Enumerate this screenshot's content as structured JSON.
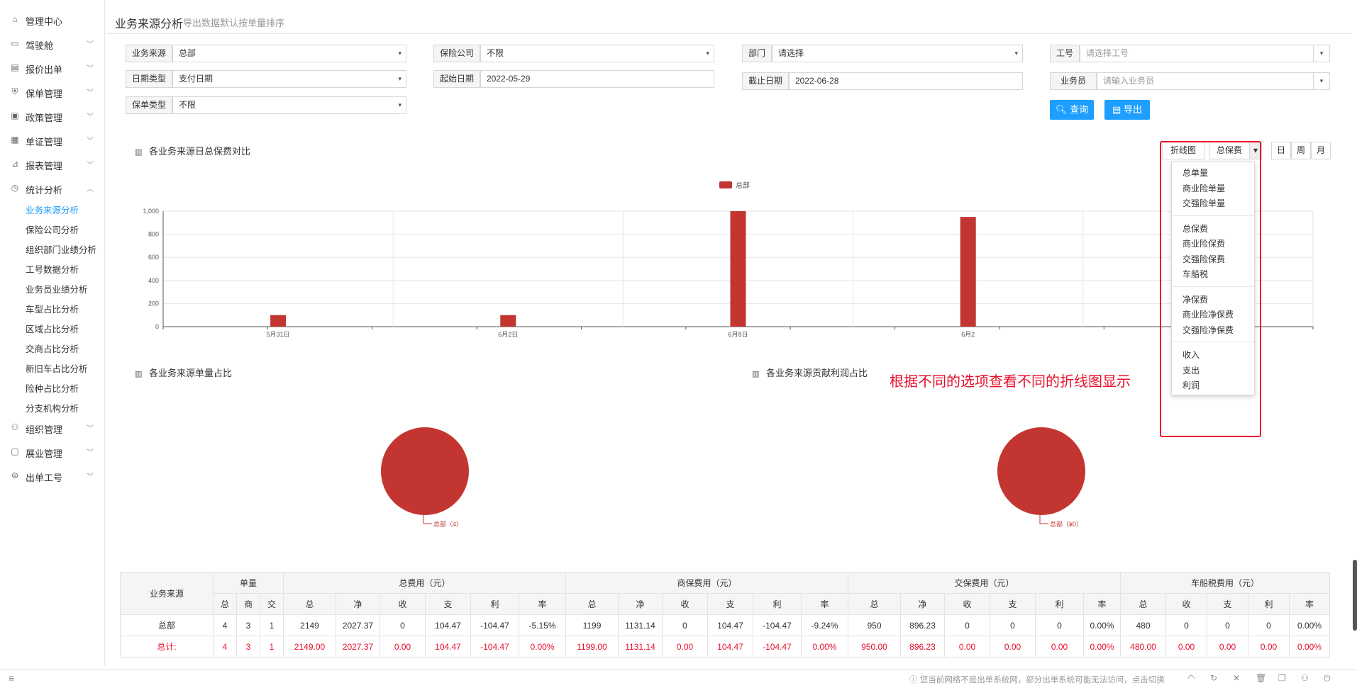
{
  "sidebar": {
    "items": [
      {
        "label": "管理中心",
        "icon": "home-icon",
        "glyph": "⌂",
        "has_children": false
      },
      {
        "label": "驾驶舱",
        "icon": "dashboard-icon",
        "glyph": "▭",
        "has_children": true
      },
      {
        "label": "报价出单",
        "icon": "quote-icon",
        "glyph": "▤",
        "has_children": true
      },
      {
        "label": "保单管理",
        "icon": "policy-icon",
        "glyph": "⛨",
        "has_children": true
      },
      {
        "label": "政策管理",
        "icon": "strategy-icon",
        "glyph": "▣",
        "has_children": true
      },
      {
        "label": "单证管理",
        "icon": "document-icon",
        "glyph": "▦",
        "has_children": true
      },
      {
        "label": "报表管理",
        "icon": "report-icon",
        "glyph": "⊿",
        "has_children": true
      },
      {
        "label": "统计分析",
        "icon": "stats-icon",
        "glyph": "◷",
        "has_children": true,
        "expanded": true
      }
    ],
    "sub_items": [
      "业务来源分析",
      "保险公司分析",
      "组织部门业绩分析",
      "工号数据分析",
      "业务员业绩分析",
      "车型占比分析",
      "区域占比分析",
      "交商占比分析",
      "新旧车占比分析",
      "险种占比分析",
      "分支机构分析"
    ],
    "bottom_items": [
      {
        "label": "组织管理",
        "icon": "organization-icon",
        "glyph": "⚇"
      },
      {
        "label": "展业管理",
        "icon": "business-icon",
        "glyph": "▢"
      },
      {
        "label": "出单工号",
        "icon": "account-icon",
        "glyph": "⊜"
      }
    ]
  },
  "header": {
    "title": "业务来源分析",
    "subtitle": "导出数据默认按单量排序"
  },
  "filters": {
    "source": {
      "label": "业务来源",
      "value": "总部"
    },
    "insurer": {
      "label": "保险公司",
      "value": "不限"
    },
    "department": {
      "label": "部门",
      "placeholder": "请选择"
    },
    "account_no": {
      "label": "工号",
      "placeholder": "请选择工号"
    },
    "date_type": {
      "label": "日期类型",
      "value": "支付日期"
    },
    "start_date": {
      "label": "起始日期",
      "value": "2022-05-29"
    },
    "end_date": {
      "label": "截止日期",
      "value": "2022-06-28"
    },
    "salesman": {
      "label": "业务员",
      "placeholder": "请输入业务员"
    },
    "policy_type": {
      "label": "保单类型",
      "value": "不限"
    }
  },
  "buttons": {
    "query": "查询",
    "export": "导出"
  },
  "chart_toolbar": {
    "chart_type": "折线图",
    "metric": "总保费",
    "periods": [
      "日",
      "周",
      "月"
    ]
  },
  "dropdown": {
    "groups": [
      [
        "总单量",
        "商业险单量",
        "交强险单量"
      ],
      [
        "总保费",
        "商业险保费",
        "交强险保费",
        "车船税"
      ],
      [
        "净保费",
        "商业险净保费",
        "交强险净保费"
      ],
      [
        "收入",
        "支出",
        "利润"
      ]
    ]
  },
  "annotation": "根据不同的选项查看不同的折线图显示",
  "sections": {
    "daily_premium": "各业务来源日总保费对比",
    "single_share": "各业务来源单量占比",
    "profit_share": "各业务来源贡献利润占比"
  },
  "chart_data": [
    {
      "type": "bar",
      "title": "各业务来源日总保费对比",
      "legend": [
        "总部"
      ],
      "legend_position": "top-center",
      "categories": [
        "5月31日",
        "6月2日",
        "6月8日",
        "6月2"
      ],
      "series": [
        {
          "name": "总部",
          "values": [
            100,
            100,
            1199,
            950
          ]
        }
      ],
      "y_ticks": [
        "0",
        "200",
        "400",
        "600",
        "800",
        "1,000"
      ],
      "ylim": [
        0,
        1000
      ],
      "grid": true,
      "color": "#c23531"
    },
    {
      "type": "pie",
      "title": "各业务来源单量占比",
      "slices": [
        {
          "name": "总部",
          "value": 4,
          "label": "总部（4）"
        }
      ],
      "color": "#c23531"
    },
    {
      "type": "pie",
      "title": "各业务来源贡献利润占比",
      "slices": [
        {
          "name": "总部",
          "value": 0,
          "label": "总部（¥0）"
        }
      ],
      "color": "#c23531"
    }
  ],
  "table": {
    "row_header": "业务来源",
    "groups": [
      {
        "label": "单量",
        "cols": [
          "总",
          "商",
          "交"
        ]
      },
      {
        "label": "总费用（元）",
        "cols": [
          "总",
          "净",
          "收",
          "支",
          "利",
          "率"
        ]
      },
      {
        "label": "商保费用（元）",
        "cols": [
          "总",
          "净",
          "收",
          "支",
          "利",
          "率"
        ]
      },
      {
        "label": "交保费用（元）",
        "cols": [
          "总",
          "净",
          "收",
          "支",
          "利",
          "率"
        ]
      },
      {
        "label": "车船税费用（元）",
        "cols": [
          "总",
          "收",
          "支",
          "利",
          "率"
        ]
      }
    ],
    "rows": [
      [
        "总部",
        "4",
        "3",
        "1",
        "2149",
        "2027.37",
        "0",
        "104.47",
        "-104.47",
        "-5.15%",
        "1199",
        "1131.14",
        "0",
        "104.47",
        "-104.47",
        "-9.24%",
        "950",
        "896.23",
        "0",
        "0",
        "0",
        "0.00%",
        "480",
        "0",
        "0",
        "0",
        "0.00%"
      ]
    ],
    "total_row": [
      "总计:",
      "4",
      "3",
      "1",
      "2149.00",
      "2027.37",
      "0.00",
      "104.47",
      "-104.47",
      "0.00%",
      "1199.00",
      "1131.14",
      "0.00",
      "104.47",
      "-104.47",
      "0.00%",
      "950.00",
      "896.23",
      "0.00",
      "0.00",
      "0.00",
      "0.00%",
      "480.00",
      "0.00",
      "0.00",
      "0.00",
      "0.00%"
    ]
  },
  "status_bar": {
    "message": "您当前网络不是出单系统网，部分出单系统可能无法访问，点击切换"
  }
}
